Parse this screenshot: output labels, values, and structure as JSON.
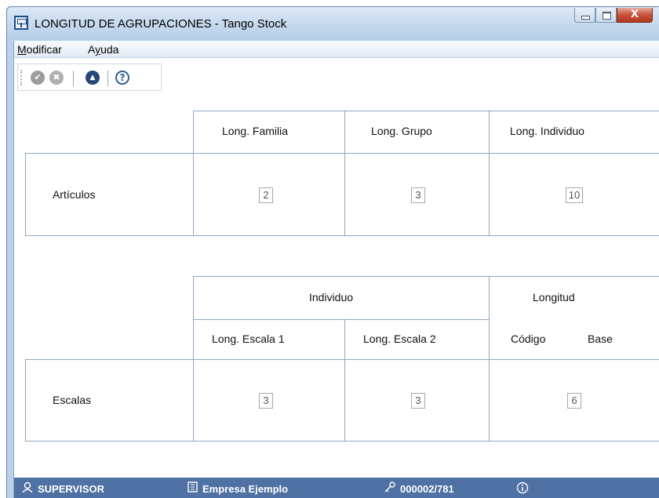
{
  "window": {
    "title": "LONGITUD DE AGRUPACIONES - Tango Stock",
    "minimize_icon": "minimize-icon",
    "maximize_icon": "maximize-icon",
    "close_label": "X"
  },
  "menu": {
    "modificar": {
      "accel": "M",
      "rest": "odificar"
    },
    "ayuda": {
      "pre": "A",
      "accel": "y",
      "rest": "uda"
    }
  },
  "toolbar": {
    "accept_symbol": "✔",
    "cancel_symbol": "✖",
    "up_symbol": "▲",
    "help_symbol": "?"
  },
  "articulos": {
    "headers": [
      "Long. Familia",
      "Long. Grupo",
      "Long. Individuo"
    ],
    "row_label": "Artículos",
    "values": [
      "2",
      "3",
      "10"
    ]
  },
  "escalas": {
    "group_individuo": "Individuo",
    "group_longitud": "Longitud",
    "headers": [
      "Long. Escala 1",
      "Long. Escala 2"
    ],
    "codigo_label": "Código",
    "base_label": "Base",
    "row_label": "Escalas",
    "values": [
      "3",
      "3",
      "6"
    ]
  },
  "status": {
    "user": "SUPERVISOR",
    "company": "Empresa Ejemplo",
    "license": "000002/781",
    "user_icon": "user-icon",
    "company_icon": "building-icon",
    "license_icon": "key-icon",
    "info_icon": "info-icon"
  },
  "colors": {
    "statusbar": "#4f71a3",
    "border": "#8fa6c1",
    "titlebar": "#c3d8ee",
    "close_button": "#c7513a"
  }
}
